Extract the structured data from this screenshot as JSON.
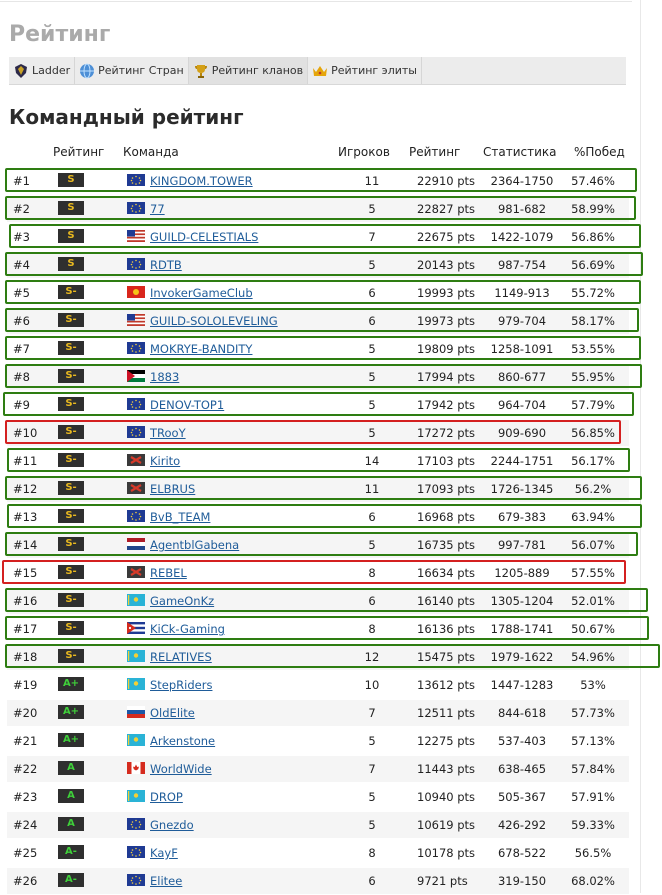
{
  "page_title": "Рейтинг",
  "tabs": [
    {
      "label": "Ladder",
      "icon": "ladder-shield-icon"
    },
    {
      "label": "Рейтинг Стран",
      "icon": "globe-icon"
    },
    {
      "label": "Рейтинг кланов",
      "icon": "trophy-icon"
    },
    {
      "label": "Рейтинг элиты",
      "icon": "crown-icon"
    }
  ],
  "section_title": "Командный рейтинг",
  "table": {
    "headers": {
      "rank_label": "Рейтинг",
      "team": "Команда",
      "players": "Игроков",
      "rating": "Рейтинг",
      "stats": "Статистика",
      "winrate": "%Побед"
    },
    "highlight_colors": {
      "green": "#2e7d12",
      "red": "#d42020"
    },
    "rows": [
      {
        "rank": "#1",
        "tier": "S",
        "flag": "eu",
        "team": "KINGDOM.TOWER",
        "players": "11",
        "rating": "22910 pts",
        "stats": "2364-1750",
        "winrate": "57.46%",
        "highlight": "green"
      },
      {
        "rank": "#2",
        "tier": "S",
        "flag": "eu",
        "team": "77",
        "players": "5",
        "rating": "22827 pts",
        "stats": "981-682",
        "winrate": "58.99%",
        "highlight": "green"
      },
      {
        "rank": "#3",
        "tier": "S",
        "flag": "us",
        "team": "GUILD-CELESTIALS",
        "players": "7",
        "rating": "22675 pts",
        "stats": "1422-1079",
        "winrate": "56.86%",
        "highlight": "green"
      },
      {
        "rank": "#4",
        "tier": "S",
        "flag": "eu",
        "team": "RDTB",
        "players": "5",
        "rating": "20143 pts",
        "stats": "987-754",
        "winrate": "56.69%",
        "highlight": "green"
      },
      {
        "rank": "#5",
        "tier": "S-",
        "flag": "kg",
        "team": "InvokerGameClub",
        "players": "6",
        "rating": "19993 pts",
        "stats": "1149-913",
        "winrate": "55.72%",
        "highlight": "green"
      },
      {
        "rank": "#6",
        "tier": "S-",
        "flag": "us",
        "team": "GUILD-SOLOLEVELING",
        "players": "6",
        "rating": "19973 pts",
        "stats": "979-704",
        "winrate": "58.17%",
        "highlight": "green"
      },
      {
        "rank": "#7",
        "tier": "S-",
        "flag": "eu",
        "team": "MOKRYE-BANDITY",
        "players": "5",
        "rating": "19809 pts",
        "stats": "1258-1091",
        "winrate": "53.55%",
        "highlight": "green"
      },
      {
        "rank": "#8",
        "tier": "S-",
        "flag": "jo",
        "team": "1883",
        "players": "5",
        "rating": "17994 pts",
        "stats": "860-677",
        "winrate": "55.95%",
        "highlight": "green"
      },
      {
        "rank": "#9",
        "tier": "S-",
        "flag": "eu",
        "team": "DENOV-TOP1",
        "players": "5",
        "rating": "17942 pts",
        "stats": "964-704",
        "winrate": "57.79%",
        "highlight": "green"
      },
      {
        "rank": "#10",
        "tier": "S-",
        "flag": "eu",
        "team": "TRooY",
        "players": "5",
        "rating": "17272 pts",
        "stats": "909-690",
        "winrate": "56.85%",
        "highlight": "red"
      },
      {
        "rank": "#11",
        "tier": "S-",
        "flag": "al",
        "team": "Kirito",
        "players": "14",
        "rating": "17103 pts",
        "stats": "2244-1751",
        "winrate": "56.17%",
        "highlight": "green"
      },
      {
        "rank": "#12",
        "tier": "S-",
        "flag": "al",
        "team": "ELBRUS",
        "players": "11",
        "rating": "17093 pts",
        "stats": "1726-1345",
        "winrate": "56.2%",
        "highlight": "green"
      },
      {
        "rank": "#13",
        "tier": "S-",
        "flag": "eu",
        "team": "BvB_TEAM",
        "players": "6",
        "rating": "16968 pts",
        "stats": "679-383",
        "winrate": "63.94%",
        "highlight": "green"
      },
      {
        "rank": "#14",
        "tier": "S-",
        "flag": "nl",
        "team": "AgentblGabena",
        "players": "5",
        "rating": "16735 pts",
        "stats": "997-781",
        "winrate": "56.07%",
        "highlight": "green"
      },
      {
        "rank": "#15",
        "tier": "S-",
        "flag": "al",
        "team": "REBEL",
        "players": "8",
        "rating": "16634 pts",
        "stats": "1205-889",
        "winrate": "57.55%",
        "highlight": "red"
      },
      {
        "rank": "#16",
        "tier": "S-",
        "flag": "kz",
        "team": "GameOnKz",
        "players": "6",
        "rating": "16140 pts",
        "stats": "1305-1204",
        "winrate": "52.01%",
        "highlight": "green"
      },
      {
        "rank": "#17",
        "tier": "S-",
        "flag": "cu",
        "team": "KiCk-Gaming",
        "players": "8",
        "rating": "16136 pts",
        "stats": "1788-1741",
        "winrate": "50.67%",
        "highlight": "green"
      },
      {
        "rank": "#18",
        "tier": "S-",
        "flag": "kz",
        "team": "RELATIVES",
        "players": "12",
        "rating": "15475 pts",
        "stats": "1979-1622",
        "winrate": "54.96%",
        "highlight": "green"
      },
      {
        "rank": "#19",
        "tier": "A+",
        "flag": "kz",
        "team": "StepRiders",
        "players": "10",
        "rating": "13612 pts",
        "stats": "1447-1283",
        "winrate": "53%",
        "highlight": ""
      },
      {
        "rank": "#20",
        "tier": "A+",
        "flag": "ru",
        "team": "OldElite",
        "players": "7",
        "rating": "12511 pts",
        "stats": "844-618",
        "winrate": "57.73%",
        "highlight": ""
      },
      {
        "rank": "#21",
        "tier": "A+",
        "flag": "kz",
        "team": "Arkenstone",
        "players": "5",
        "rating": "12275 pts",
        "stats": "537-403",
        "winrate": "57.13%",
        "highlight": ""
      },
      {
        "rank": "#22",
        "tier": "A",
        "flag": "ca",
        "team": "WorldWide",
        "players": "7",
        "rating": "11443 pts",
        "stats": "638-465",
        "winrate": "57.84%",
        "highlight": ""
      },
      {
        "rank": "#23",
        "tier": "A",
        "flag": "kz",
        "team": "DROP",
        "players": "5",
        "rating": "10940 pts",
        "stats": "505-367",
        "winrate": "57.91%",
        "highlight": ""
      },
      {
        "rank": "#24",
        "tier": "A",
        "flag": "eu",
        "team": "Gnezdo",
        "players": "5",
        "rating": "10619 pts",
        "stats": "426-292",
        "winrate": "59.33%",
        "highlight": ""
      },
      {
        "rank": "#25",
        "tier": "A-",
        "flag": "eu",
        "team": "KayF",
        "players": "8",
        "rating": "10178 pts",
        "stats": "678-522",
        "winrate": "56.5%",
        "highlight": ""
      },
      {
        "rank": "#26",
        "tier": "A-",
        "flag": "eu",
        "team": "Elitee",
        "players": "6",
        "rating": "9721 pts",
        "stats": "319-150",
        "winrate": "68.02%",
        "highlight": ""
      }
    ]
  }
}
